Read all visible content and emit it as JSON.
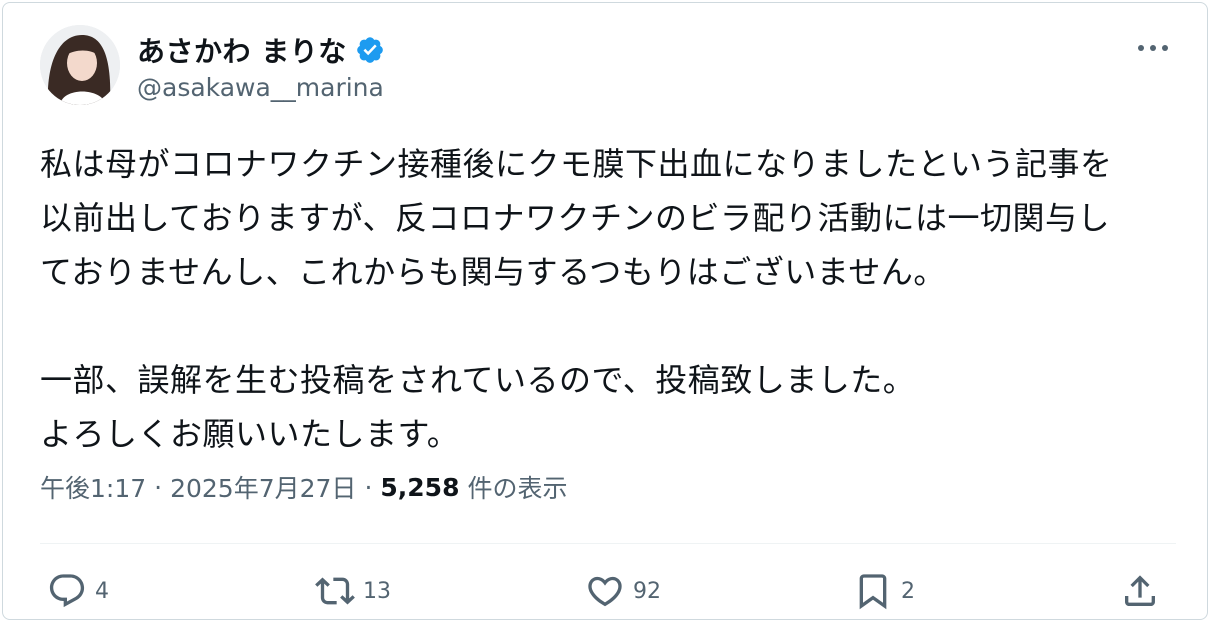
{
  "user": {
    "name": "あさかわ まりな",
    "handle": "@asakawa__marina"
  },
  "tweet": {
    "text": "私は母がコロナワクチン接種後にクモ膜下出血になりましたという記事を\n以前出しておりますが、反コロナワクチンのビラ配り活動には一切関与し\nておりませんし、これからも関与するつもりはございません。\n\n一部、誤解を生む投稿をされているので、投稿致しました。\nよろしくお願いいたします。",
    "time": "午後1:17",
    "date": "2025年7月27日",
    "views_count": "5,258",
    "views_label": "件の表示"
  },
  "actions": {
    "replies": "4",
    "retweets": "13",
    "likes": "92",
    "bookmarks": "2"
  },
  "colors": {
    "verified": "#1d9bf0",
    "text": "#0f1419",
    "secondary": "#536471"
  },
  "icons": {
    "avatar": "avatar",
    "verified": "verified-badge-icon",
    "more": "more-options-icon",
    "reply": "reply-icon",
    "retweet": "retweet-icon",
    "like": "heart-icon",
    "bookmark": "bookmark-icon",
    "share": "share-icon"
  }
}
